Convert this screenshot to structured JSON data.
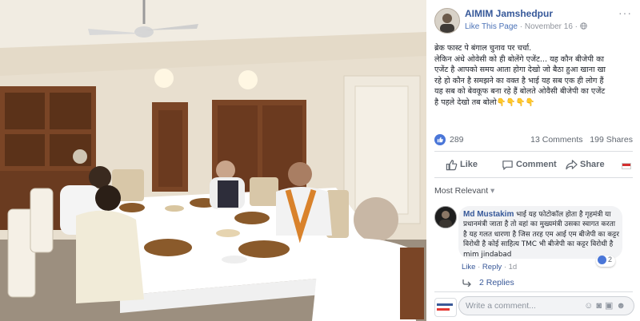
{
  "post": {
    "page_name": "AIMIM Jamshedpur",
    "like_page": "Like This Page",
    "date": "November 16",
    "more": "···",
    "lines": [
      "ब्रेक फास्ट पे बंगाल चुनाव पर चर्चा.",
      "लेकिन अंधे ओवेसी को ही बोलेंगे एजेंट... यह कौन बीजेपी का",
      "एजेंट है आपको समय आता होगा देखो जो बैठा हुआ खाना खा",
      "रहे हो कौन है समझने का वक्त है भाई यह सब एक ही लोग हैं",
      "यह सब को बेवकूफ बना रहे हैं बोलते ओवैसी बीजेपी का एजेंट",
      "है पहले देखो तब बोलो👇👇👇👇"
    ],
    "like_count": "289",
    "comments_count": "13 Comments",
    "shares_count": "199 Shares",
    "actions": {
      "like": "Like",
      "comment": "Comment",
      "share": "Share"
    },
    "sort_label": "Most Relevant"
  },
  "comment": {
    "author": "Md Mustakim",
    "text": "भाई यह फोटोकॉल होता है गृहमंत्री या प्रधानमंत्री जाता है तो वहां का मुख्यमंत्री उसका स्वागत करता है यह गलत धारणा है जिस तरह एम आई एम बीजेपी का कट्टर विरोधी है कोई साहित्य TMC भी बीजेपी का कट्टर विरोधी है mim jindabad",
    "like": "Like",
    "reply": "Reply",
    "time": "1d",
    "reaction_count": "2",
    "replies": "2 Replies"
  },
  "composer": {
    "placeholder": "Write a comment..."
  },
  "colors": {
    "link": "#365899",
    "like_blue": "#4a76d8",
    "meta_gray": "#90949c"
  }
}
